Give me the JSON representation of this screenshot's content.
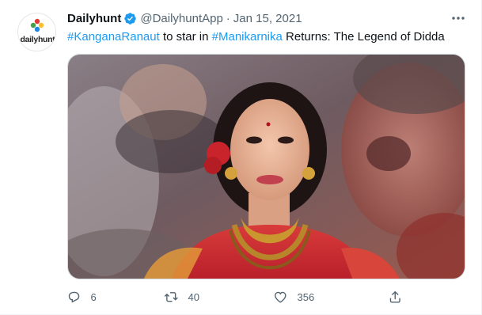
{
  "account": {
    "display_name": "Dailyhunt",
    "handle": "@DailyhuntApp",
    "separator": "·",
    "date": "Jan 15, 2021",
    "logo_text": "dailyhunt",
    "verified_icon": "verified-badge-icon"
  },
  "tweet": {
    "hashtag_1": "#KanganaRanaut",
    "text_1": " to star in ",
    "hashtag_2": "#Manikarnika",
    "text_2": " Returns: The Legend of Didda"
  },
  "media": {
    "alt": "Photo of actress in traditional red attire with gold jewellery in front of a movie poster backdrop"
  },
  "actions": {
    "reply_count": "6",
    "retweet_count": "40",
    "like_count": "356"
  },
  "colors": {
    "link": "#1d9bf0",
    "verified": "#1d9bf0",
    "muted": "#536471",
    "text": "#0f1419"
  },
  "icons": [
    "reply-icon",
    "retweet-icon",
    "like-icon",
    "share-icon",
    "more-icon"
  ]
}
